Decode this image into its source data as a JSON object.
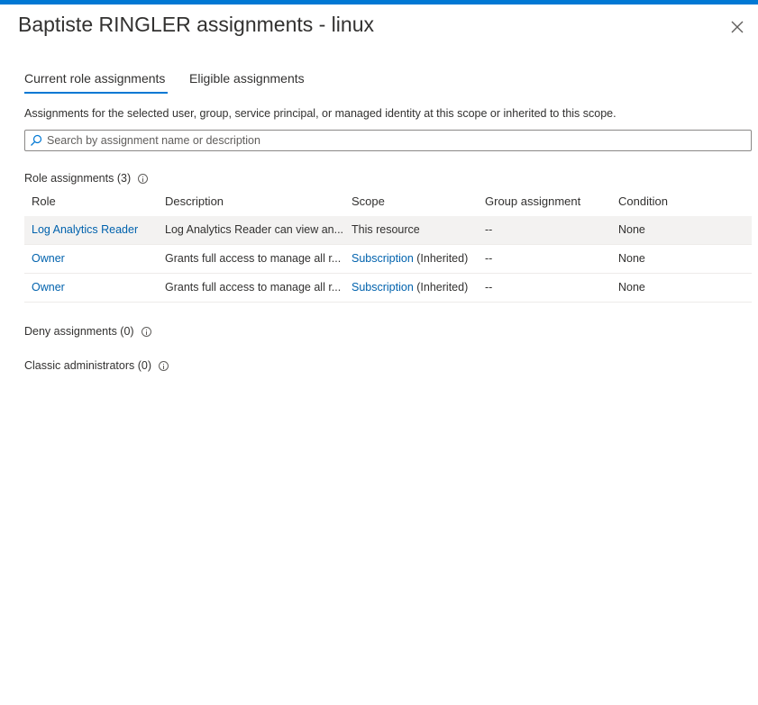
{
  "panel": {
    "title": "Baptiste RINGLER assignments - linux",
    "close_icon": "close-icon"
  },
  "tabs": [
    {
      "label": "Current role assignments",
      "active": true
    },
    {
      "label": "Eligible assignments",
      "active": false
    }
  ],
  "description": "Assignments for the selected user, group, service principal, or managed identity at this scope or inherited to this scope.",
  "search": {
    "placeholder": "Search by assignment name or description",
    "value": ""
  },
  "role_assignments": {
    "label": "Role assignments (3)",
    "columns": [
      "Role",
      "Description",
      "Scope",
      "Group assignment",
      "Condition"
    ],
    "rows": [
      {
        "role": "Log Analytics Reader",
        "description": "Log Analytics Reader can view an...",
        "scope": "This resource",
        "scope_suffix": "",
        "group": "--",
        "condition": "None"
      },
      {
        "role": "Owner",
        "description": "Grants full access to manage all r...",
        "scope": "Subscription",
        "scope_suffix": " (Inherited)",
        "group": "--",
        "condition": "None"
      },
      {
        "role": "Owner",
        "description": "Grants full access to manage all r...",
        "scope": "Subscription",
        "scope_suffix": " (Inherited)",
        "group": "--",
        "condition": "None"
      }
    ]
  },
  "deny_assignments": {
    "label": "Deny assignments (0)"
  },
  "classic_administrators": {
    "label": "Classic administrators (0)"
  },
  "colors": {
    "accent": "#0078d4",
    "link": "#0062ad",
    "selected_row": "#f3f2f1"
  }
}
